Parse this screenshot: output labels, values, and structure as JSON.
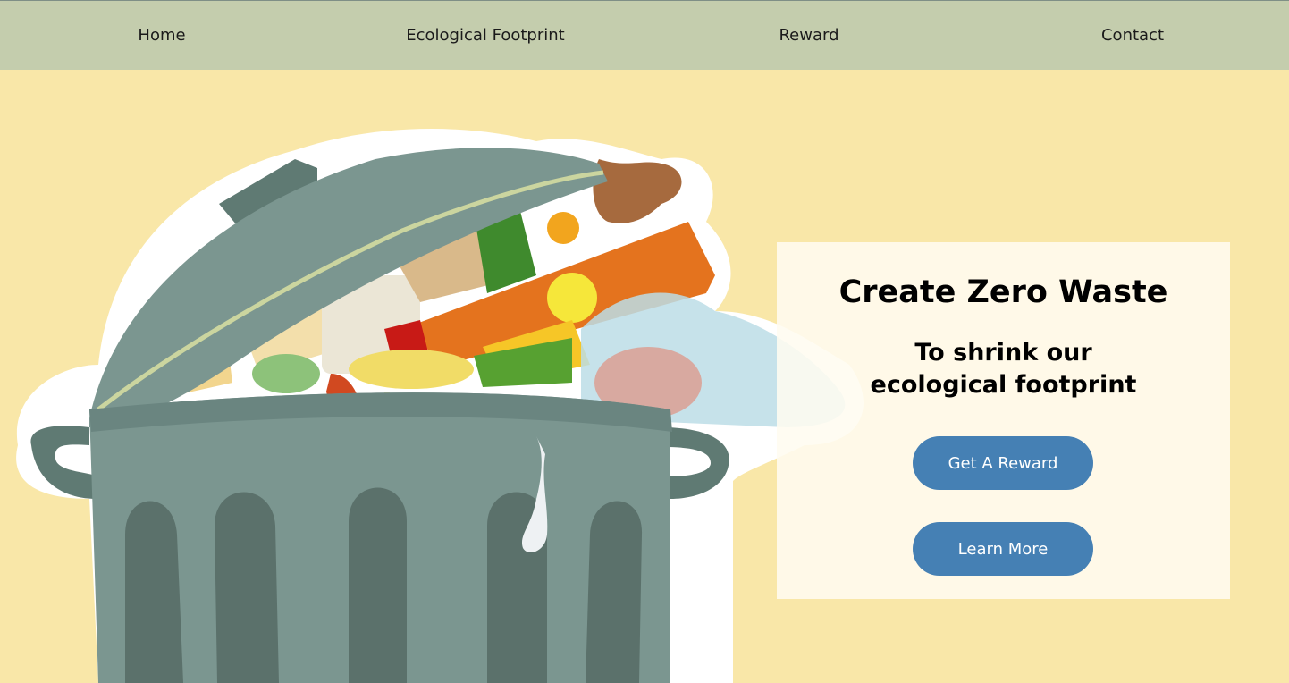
{
  "nav": {
    "items": [
      {
        "label": "Home"
      },
      {
        "label": "Ecological Footprint"
      },
      {
        "label": "Reward"
      },
      {
        "label": "Contact"
      }
    ]
  },
  "hero": {
    "illustration": "overflowing-trash-can-with-food-waste"
  },
  "card": {
    "title": "Create Zero Waste",
    "subtitle": "To shrink our ecological footprint",
    "primary_button": "Get A Reward",
    "secondary_button": "Learn More"
  },
  "colors": {
    "page_background": "#f9e7a8",
    "nav_background": "#c4cdad",
    "button": "#4580b4",
    "card_background": "#fffcf0"
  }
}
